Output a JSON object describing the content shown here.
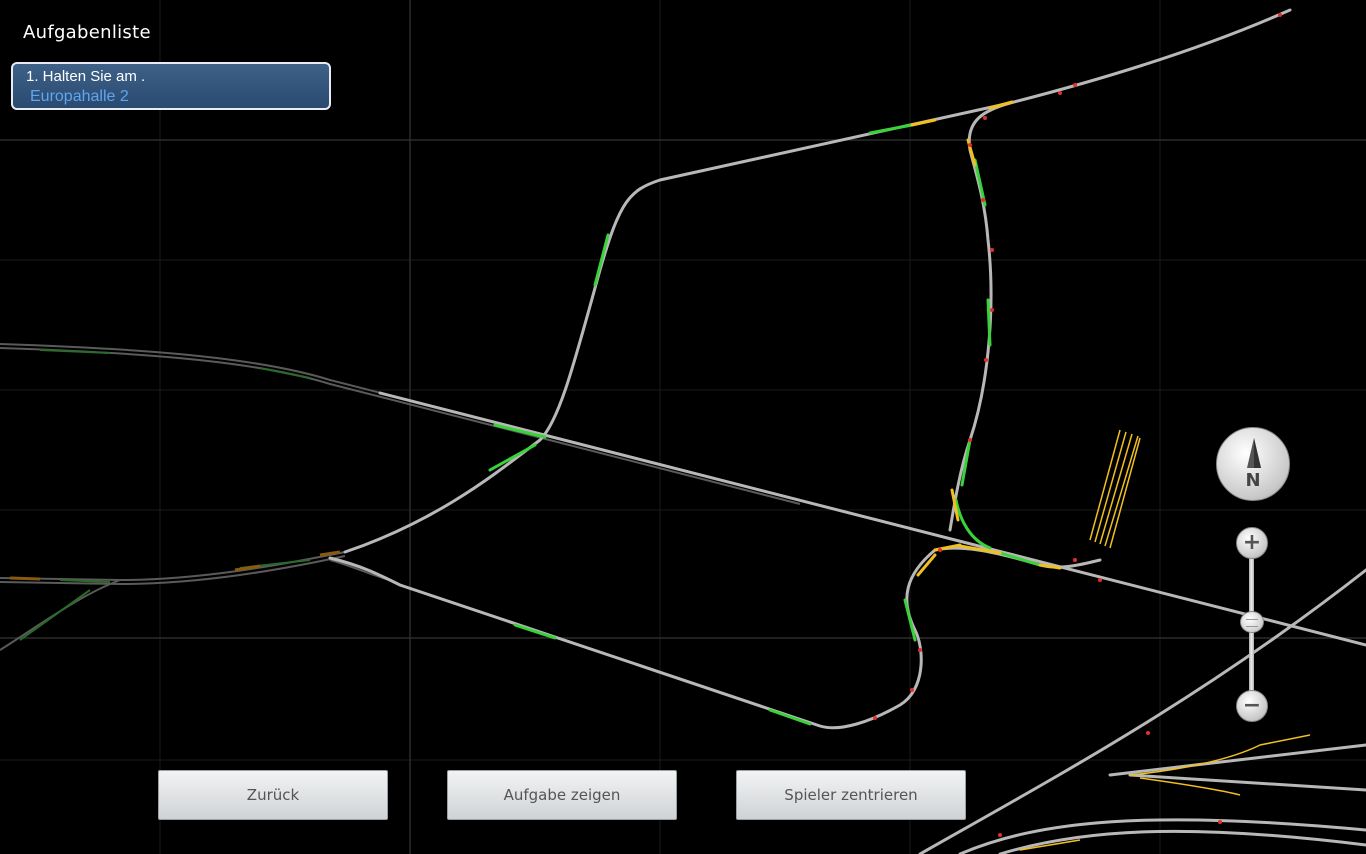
{
  "task_panel": {
    "title": "Aufgabenliste",
    "task_line1": "1. Halten Sie am .",
    "task_line2": "Europahalle 2"
  },
  "buttons": {
    "back": "Zurück",
    "show_task": "Aufgabe zeigen",
    "center_player": "Spieler zentrieren"
  },
  "compass": {
    "label": "N"
  },
  "zoom": {
    "plus": "+",
    "minus": "−",
    "level": 0.45
  },
  "colors": {
    "background": "#000000",
    "grid": "#1e1e1e",
    "track": "#b8b8b8",
    "track_free": "#3ad23a",
    "track_reserved": "#f0c020",
    "signal": "#e03030",
    "task_box": "#2f5079",
    "task_highlight": "#5fa6ee"
  }
}
